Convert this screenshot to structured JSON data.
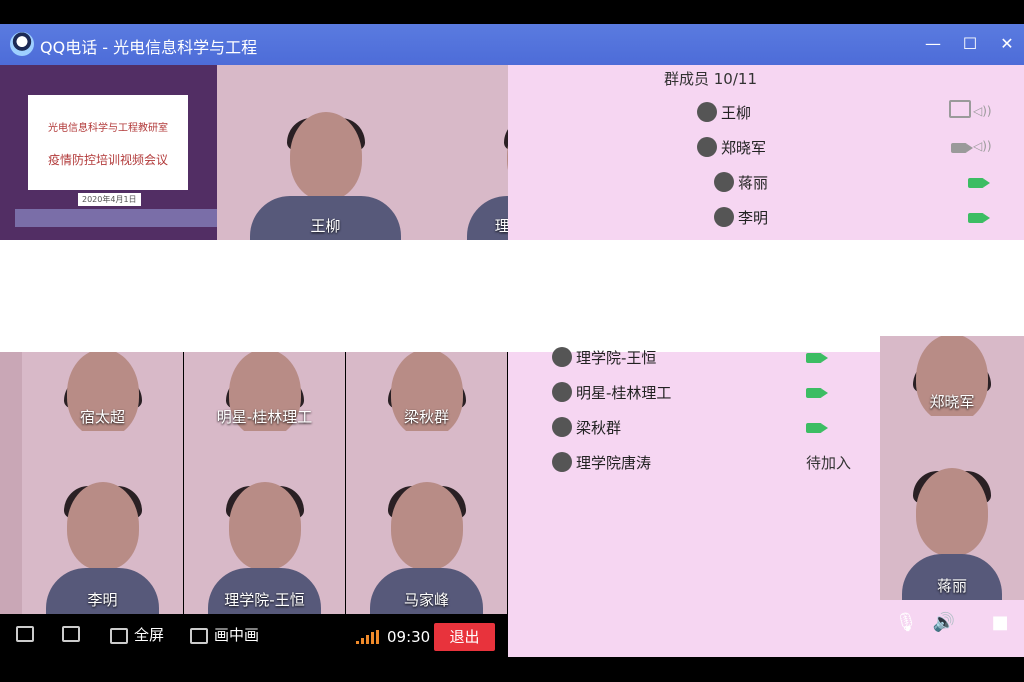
{
  "window": {
    "title": "QQ电话 - 光电信息科学与工程",
    "minimize": "—",
    "maximize": "☐",
    "close": "✕"
  },
  "slide": {
    "dept": "光电信息科学与工程教研室",
    "title": "疫情防控培训视频会议",
    "date": "2020年4月1日"
  },
  "top_videos": [
    {
      "name": "王柳"
    },
    {
      "name": "理学院-肖剑荣"
    }
  ],
  "grid_videos": [
    {
      "name": "宿太超"
    },
    {
      "name": "明星-桂林理工"
    },
    {
      "name": "梁秋群"
    },
    {
      "name": "李明"
    },
    {
      "name": "理学院-王恒"
    },
    {
      "name": "马家峰"
    }
  ],
  "right_videos": [
    {
      "name": "郑晓军"
    },
    {
      "name": "蒋丽"
    }
  ],
  "members": {
    "header": "群成员 10/11",
    "list": [
      {
        "name": "王柳",
        "status": "speaker",
        "icon": "screen-share-icon"
      },
      {
        "name": "郑晓军",
        "status": "camera-off",
        "icon": "camera-icon"
      },
      {
        "name": "蒋丽",
        "status": "camera-on",
        "icon": "camera-icon"
      },
      {
        "name": "李明",
        "status": "camera-on",
        "icon": "camera-icon"
      },
      {
        "name": "理学院-王恒",
        "status": "camera-on",
        "icon": "camera-icon"
      },
      {
        "name": "明星-桂林理工",
        "status": "camera-on",
        "icon": "camera-icon"
      },
      {
        "name": "梁秋群",
        "status": "camera-on",
        "icon": "camera-icon"
      },
      {
        "name": "理学院唐涛",
        "status": "待加入",
        "icon": ""
      }
    ]
  },
  "toolbar": {
    "fullscreen": "全屏",
    "pip": "画中画",
    "timer": "09:30",
    "exit": "退出"
  },
  "colors": {
    "accent": "#4d6cd8",
    "exit": "#e8333c",
    "camera_on": "#3cbd63",
    "panel": "#f6d6f2"
  }
}
